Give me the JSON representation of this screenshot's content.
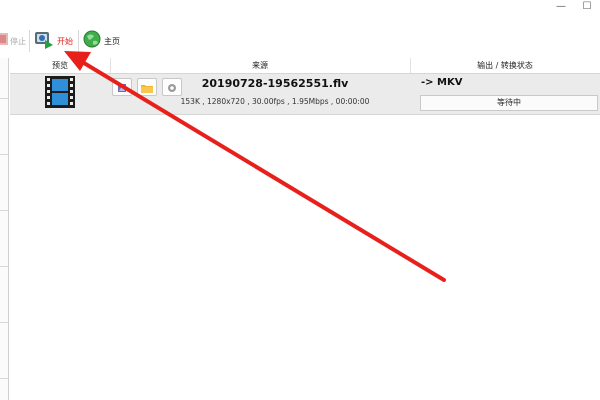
{
  "window": {
    "minimize_glyph": "—",
    "maximize_glyph": "☐"
  },
  "toolbar": {
    "stop_label": "停止",
    "start_label": "开始",
    "home_label": "主页"
  },
  "table": {
    "columns": [
      "预览",
      "来源",
      "输出 / 转换状态"
    ],
    "rows": [
      {
        "filename": "20190728-19562551.flv",
        "info": "153K , 1280x720 , 30.00fps , 1.95Mbps , 00:00:00",
        "target": "-> MKV",
        "status": "等待中"
      }
    ]
  },
  "colors": {
    "accent_red": "#e8201c",
    "start_label": "#e0221a",
    "row_bg": "#ebebeb"
  }
}
